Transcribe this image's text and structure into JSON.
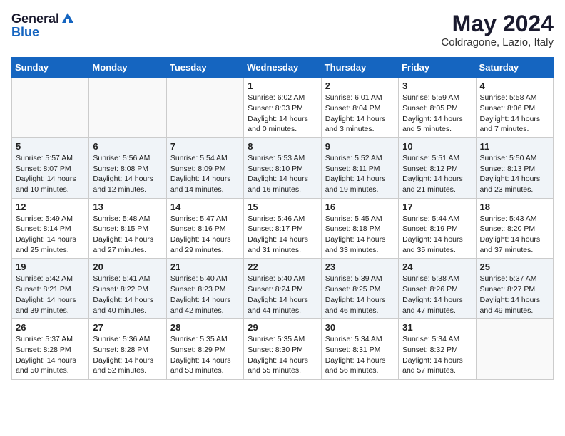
{
  "header": {
    "logo_general": "General",
    "logo_blue": "Blue",
    "month_title": "May 2024",
    "location": "Coldragone, Lazio, Italy"
  },
  "weekdays": [
    "Sunday",
    "Monday",
    "Tuesday",
    "Wednesday",
    "Thursday",
    "Friday",
    "Saturday"
  ],
  "weeks": [
    [
      {
        "day": "",
        "info": ""
      },
      {
        "day": "",
        "info": ""
      },
      {
        "day": "",
        "info": ""
      },
      {
        "day": "1",
        "info": "Sunrise: 6:02 AM\nSunset: 8:03 PM\nDaylight: 14 hours\nand 0 minutes."
      },
      {
        "day": "2",
        "info": "Sunrise: 6:01 AM\nSunset: 8:04 PM\nDaylight: 14 hours\nand 3 minutes."
      },
      {
        "day": "3",
        "info": "Sunrise: 5:59 AM\nSunset: 8:05 PM\nDaylight: 14 hours\nand 5 minutes."
      },
      {
        "day": "4",
        "info": "Sunrise: 5:58 AM\nSunset: 8:06 PM\nDaylight: 14 hours\nand 7 minutes."
      }
    ],
    [
      {
        "day": "5",
        "info": "Sunrise: 5:57 AM\nSunset: 8:07 PM\nDaylight: 14 hours\nand 10 minutes."
      },
      {
        "day": "6",
        "info": "Sunrise: 5:56 AM\nSunset: 8:08 PM\nDaylight: 14 hours\nand 12 minutes."
      },
      {
        "day": "7",
        "info": "Sunrise: 5:54 AM\nSunset: 8:09 PM\nDaylight: 14 hours\nand 14 minutes."
      },
      {
        "day": "8",
        "info": "Sunrise: 5:53 AM\nSunset: 8:10 PM\nDaylight: 14 hours\nand 16 minutes."
      },
      {
        "day": "9",
        "info": "Sunrise: 5:52 AM\nSunset: 8:11 PM\nDaylight: 14 hours\nand 19 minutes."
      },
      {
        "day": "10",
        "info": "Sunrise: 5:51 AM\nSunset: 8:12 PM\nDaylight: 14 hours\nand 21 minutes."
      },
      {
        "day": "11",
        "info": "Sunrise: 5:50 AM\nSunset: 8:13 PM\nDaylight: 14 hours\nand 23 minutes."
      }
    ],
    [
      {
        "day": "12",
        "info": "Sunrise: 5:49 AM\nSunset: 8:14 PM\nDaylight: 14 hours\nand 25 minutes."
      },
      {
        "day": "13",
        "info": "Sunrise: 5:48 AM\nSunset: 8:15 PM\nDaylight: 14 hours\nand 27 minutes."
      },
      {
        "day": "14",
        "info": "Sunrise: 5:47 AM\nSunset: 8:16 PM\nDaylight: 14 hours\nand 29 minutes."
      },
      {
        "day": "15",
        "info": "Sunrise: 5:46 AM\nSunset: 8:17 PM\nDaylight: 14 hours\nand 31 minutes."
      },
      {
        "day": "16",
        "info": "Sunrise: 5:45 AM\nSunset: 8:18 PM\nDaylight: 14 hours\nand 33 minutes."
      },
      {
        "day": "17",
        "info": "Sunrise: 5:44 AM\nSunset: 8:19 PM\nDaylight: 14 hours\nand 35 minutes."
      },
      {
        "day": "18",
        "info": "Sunrise: 5:43 AM\nSunset: 8:20 PM\nDaylight: 14 hours\nand 37 minutes."
      }
    ],
    [
      {
        "day": "19",
        "info": "Sunrise: 5:42 AM\nSunset: 8:21 PM\nDaylight: 14 hours\nand 39 minutes."
      },
      {
        "day": "20",
        "info": "Sunrise: 5:41 AM\nSunset: 8:22 PM\nDaylight: 14 hours\nand 40 minutes."
      },
      {
        "day": "21",
        "info": "Sunrise: 5:40 AM\nSunset: 8:23 PM\nDaylight: 14 hours\nand 42 minutes."
      },
      {
        "day": "22",
        "info": "Sunrise: 5:40 AM\nSunset: 8:24 PM\nDaylight: 14 hours\nand 44 minutes."
      },
      {
        "day": "23",
        "info": "Sunrise: 5:39 AM\nSunset: 8:25 PM\nDaylight: 14 hours\nand 46 minutes."
      },
      {
        "day": "24",
        "info": "Sunrise: 5:38 AM\nSunset: 8:26 PM\nDaylight: 14 hours\nand 47 minutes."
      },
      {
        "day": "25",
        "info": "Sunrise: 5:37 AM\nSunset: 8:27 PM\nDaylight: 14 hours\nand 49 minutes."
      }
    ],
    [
      {
        "day": "26",
        "info": "Sunrise: 5:37 AM\nSunset: 8:28 PM\nDaylight: 14 hours\nand 50 minutes."
      },
      {
        "day": "27",
        "info": "Sunrise: 5:36 AM\nSunset: 8:28 PM\nDaylight: 14 hours\nand 52 minutes."
      },
      {
        "day": "28",
        "info": "Sunrise: 5:35 AM\nSunset: 8:29 PM\nDaylight: 14 hours\nand 53 minutes."
      },
      {
        "day": "29",
        "info": "Sunrise: 5:35 AM\nSunset: 8:30 PM\nDaylight: 14 hours\nand 55 minutes."
      },
      {
        "day": "30",
        "info": "Sunrise: 5:34 AM\nSunset: 8:31 PM\nDaylight: 14 hours\nand 56 minutes."
      },
      {
        "day": "31",
        "info": "Sunrise: 5:34 AM\nSunset: 8:32 PM\nDaylight: 14 hours\nand 57 minutes."
      },
      {
        "day": "",
        "info": ""
      }
    ]
  ]
}
